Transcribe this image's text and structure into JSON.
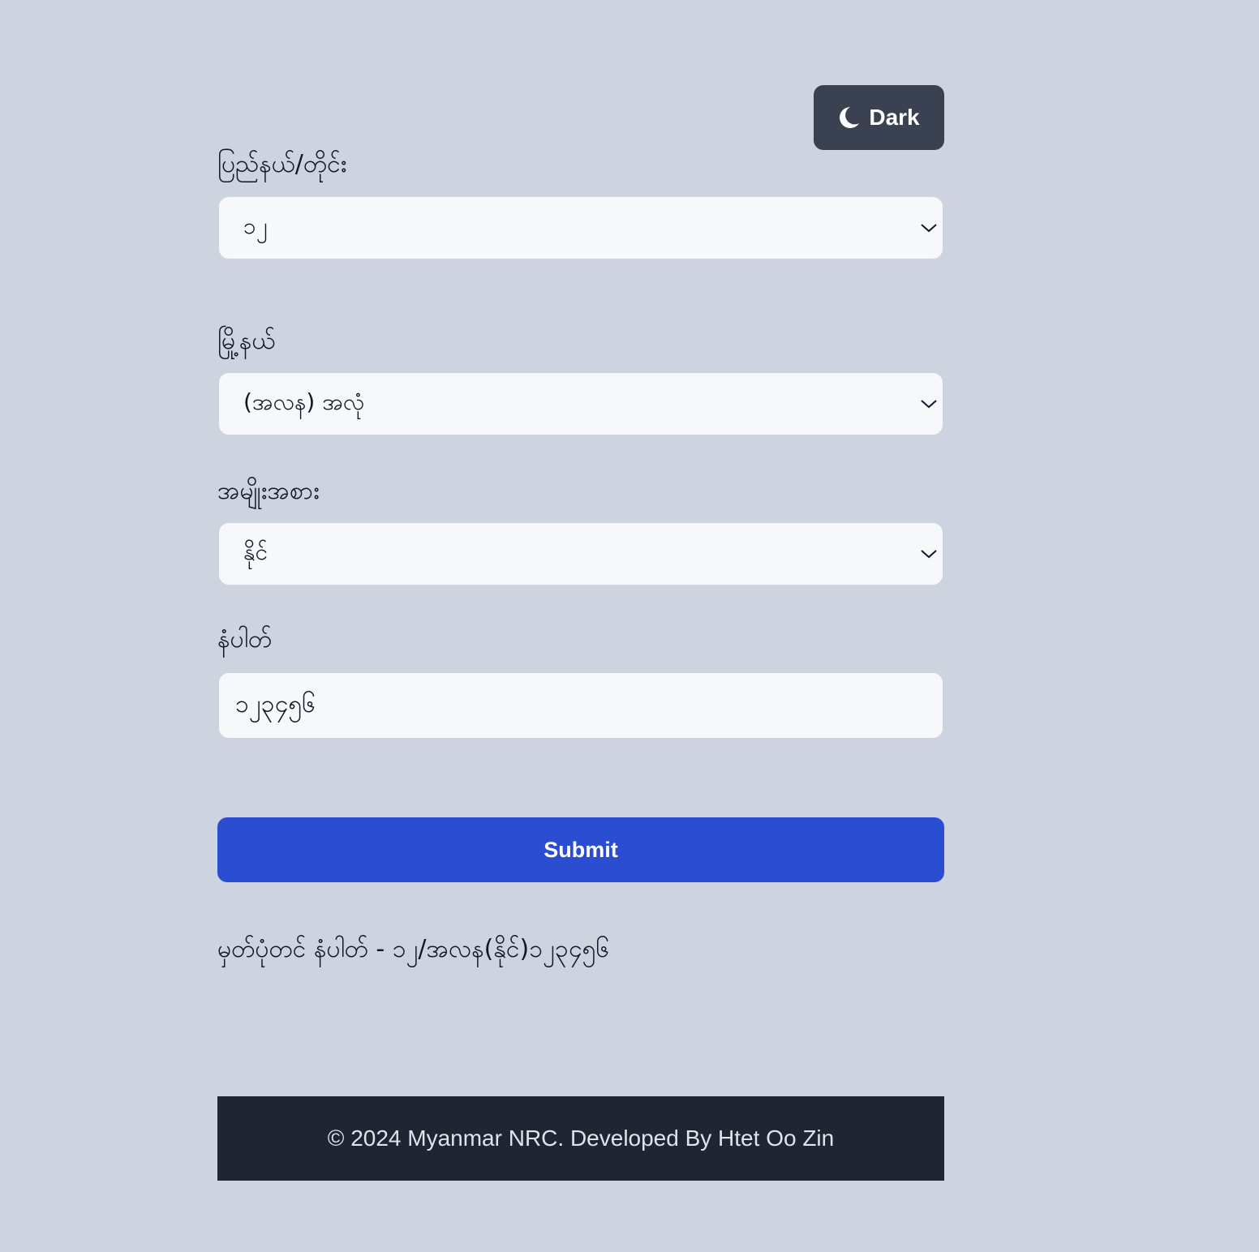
{
  "theme_toggle": {
    "label": "Dark",
    "icon": "moon-icon"
  },
  "form": {
    "state": {
      "label": "ပြည်နယ်/တိုင်း",
      "value": "၁၂"
    },
    "township": {
      "label": "မြို့နယ်",
      "value": "(အလန) အလုံ"
    },
    "type": {
      "label": "အမျိုးအစား",
      "value": "နိုင်"
    },
    "number": {
      "label": "နံပါတ်",
      "value": "၁၂၃၄၅၆"
    },
    "submit_label": "Submit"
  },
  "result": {
    "text": "မှတ်ပုံတင် နံပါတ် - ၁၂/အလန(နိုင်)၁၂၃၄၅၆"
  },
  "footer": {
    "text": "© 2024 Myanmar NRC. Developed By Htet Oo Zin"
  },
  "colors": {
    "background": "#cdd4df",
    "toggle_bg": "#3a4150",
    "input_bg": "#f6f8fa",
    "primary": "#2b4dd1",
    "footer_bg": "#1f2533"
  }
}
